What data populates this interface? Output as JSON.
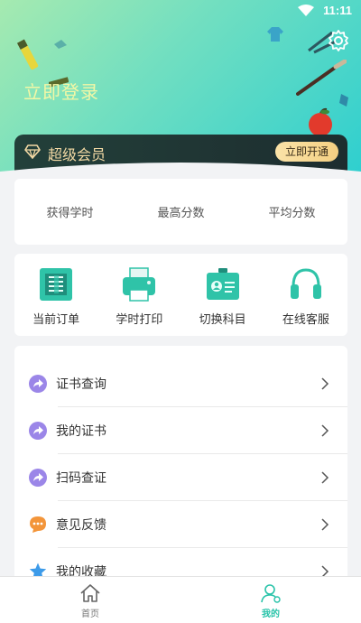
{
  "status_bar": {
    "time": "11:11"
  },
  "header": {
    "login_text": "立即登录"
  },
  "vip": {
    "title": "超级会员",
    "button_label": "立即开通"
  },
  "stats": [
    {
      "label": "获得学时"
    },
    {
      "label": "最高分数"
    },
    {
      "label": "平均分数"
    }
  ],
  "tools": [
    {
      "label": "当前订单",
      "icon": "order-icon"
    },
    {
      "label": "学时打印",
      "icon": "printer-icon"
    },
    {
      "label": "切换科目",
      "icon": "id-card-icon"
    },
    {
      "label": "在线客服",
      "icon": "headset-icon"
    }
  ],
  "menu": [
    {
      "label": "证书查询",
      "icon": "share-arrow-icon"
    },
    {
      "label": "我的证书",
      "icon": "share-arrow-icon"
    },
    {
      "label": "扫码查证",
      "icon": "share-arrow-icon"
    },
    {
      "label": "意见反馈",
      "icon": "chat-bubble-icon"
    },
    {
      "label": "我的收藏",
      "icon": "star-icon"
    }
  ],
  "tabbar": [
    {
      "label": "首页",
      "icon": "home-icon",
      "active": false
    },
    {
      "label": "我的",
      "icon": "user-icon",
      "active": true
    }
  ],
  "colors": {
    "accent": "#28c3a9",
    "vip_gold": "#f3d9a4",
    "menu_icon_purple": "#9b86e8",
    "feedback_orange": "#f3953a",
    "star_blue": "#3d9be9"
  }
}
